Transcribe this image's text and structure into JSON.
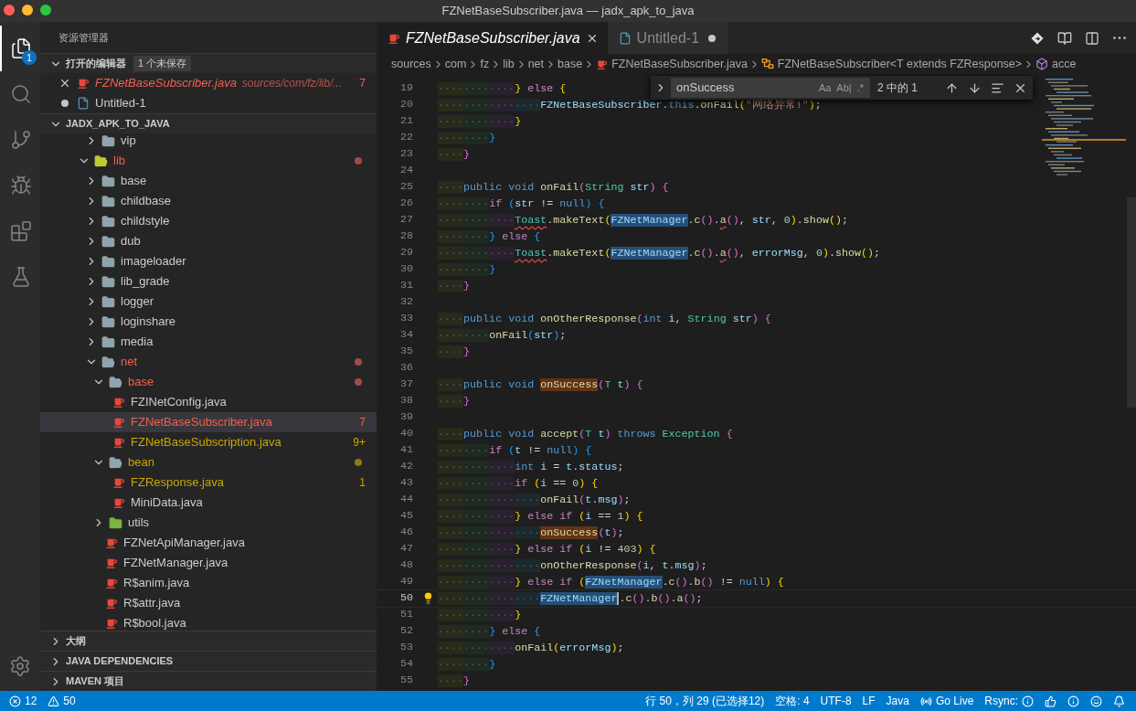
{
  "window": {
    "title": "FZNetBaseSubscriber.java — jadx_apk_to_java"
  },
  "activity_bar": [
    {
      "kind": "explorer",
      "selected": true,
      "badge": "1"
    },
    {
      "kind": "search",
      "selected": false
    },
    {
      "kind": "source-control",
      "selected": false
    },
    {
      "kind": "debug",
      "selected": false
    },
    {
      "kind": "extensions",
      "selected": false
    },
    {
      "kind": "testing",
      "selected": false
    }
  ],
  "sidebar": {
    "title": "资源管理器",
    "open_editors": {
      "label": "打开的编辑器",
      "expanded": true,
      "badge": "1 个未保存",
      "items": [
        {
          "name": "FZNetBaseSubscriber.java",
          "path": "sources/com/fz/lib/...",
          "badge": "7",
          "kind": "java-file",
          "has_errors": true,
          "preview": true,
          "dirty": false
        },
        {
          "name": "Untitled-1",
          "kind": "text-file",
          "dirty": true,
          "preview": false
        }
      ]
    },
    "project": {
      "label": "JADX_APK_TO_JAVA",
      "expanded": true,
      "tree": [
        {
          "children": [
            {
              "name": "vip",
              "kind": "folder",
              "expanded": false
            }
          ]
        },
        {
          "name": "lib",
          "kind": "lib-folder",
          "expanded": true,
          "has_errors": true,
          "children": [
            {
              "name": "base",
              "kind": "folder",
              "expanded": false
            },
            {
              "name": "childbase",
              "kind": "folder",
              "expanded": false
            },
            {
              "name": "childstyle",
              "kind": "folder",
              "expanded": false
            },
            {
              "name": "dub",
              "kind": "folder",
              "expanded": false
            },
            {
              "name": "imageloader",
              "kind": "folder",
              "expanded": false
            },
            {
              "name": "lib_grade",
              "kind": "folder",
              "expanded": false
            },
            {
              "name": "logger",
              "kind": "folder",
              "expanded": false
            },
            {
              "name": "loginshare",
              "kind": "folder",
              "expanded": false
            },
            {
              "name": "media",
              "kind": "folder",
              "expanded": false
            },
            {
              "name": "net",
              "kind": "folder",
              "expanded": true,
              "has_errors": true,
              "children": [
                {
                  "name": "base",
                  "kind": "folder",
                  "expanded": true,
                  "has_errors": true,
                  "children": [
                    {
                      "name": "FZINetConfig.java",
                      "kind": "java-file",
                      "selected": false
                    },
                    {
                      "name": "FZNetBaseSubscriber.java",
                      "kind": "java-file",
                      "has_errors": true,
                      "badge": "7",
                      "selected": true
                    },
                    {
                      "name": "FZNetBaseSubscription.java",
                      "kind": "java-file",
                      "has_warnings": true,
                      "badge": "9+",
                      "selected": false
                    }
                  ]
                },
                {
                  "name": "bean",
                  "kind": "folder",
                  "expanded": true,
                  "has_warnings": true,
                  "children": [
                    {
                      "name": "FZResponse.java",
                      "kind": "java-file",
                      "has_warnings": true,
                      "badge": "1",
                      "selected": false
                    },
                    {
                      "name": "MiniData.java",
                      "kind": "java-file",
                      "selected": false
                    }
                  ]
                },
                {
                  "name": "utils",
                  "kind": "utils-folder",
                  "expanded": false
                },
                {
                  "name": "FZNetApiManager.java",
                  "kind": "java-file",
                  "selected": false
                },
                {
                  "name": "FZNetManager.java",
                  "kind": "java-file",
                  "selected": false
                },
                {
                  "name": "R$anim.java",
                  "kind": "java-file",
                  "selected": false
                },
                {
                  "name": "R$attr.java",
                  "kind": "java-file",
                  "selected": false
                },
                {
                  "name": "R$bool.java",
                  "kind": "java-file",
                  "selected": false
                }
              ]
            }
          ]
        }
      ]
    },
    "sections": [
      {
        "label": "大纲",
        "expanded": false
      },
      {
        "label": "JAVA DEPENDENCIES",
        "expanded": false
      },
      {
        "label": "MAVEN 项目",
        "expanded": false
      }
    ]
  },
  "tabs": [
    {
      "label": "FZNetBaseSubscriber.java",
      "kind": "java-file",
      "selected": true,
      "preview": true,
      "dirty": false
    },
    {
      "label": "Untitled-1",
      "kind": "text-file",
      "selected": false,
      "preview": false,
      "dirty": true
    }
  ],
  "editor_actions": [
    {
      "kind": "open-changes"
    },
    {
      "kind": "preview"
    },
    {
      "kind": "split"
    },
    {
      "kind": "more"
    }
  ],
  "breadcrumbs": [
    {
      "label": "sources"
    },
    {
      "label": "com"
    },
    {
      "label": "fz"
    },
    {
      "label": "lib"
    },
    {
      "label": "net"
    },
    {
      "label": "base"
    },
    {
      "label": "FZNetBaseSubscriber.java",
      "kind": "java-file"
    },
    {
      "label": "FZNetBaseSubscriber<T extends FZResponse>",
      "kind": "class"
    },
    {
      "label": "acce",
      "kind": "method"
    }
  ],
  "find_widget": {
    "value": "onSuccess",
    "options": [
      "Aa",
      "Ab|",
      ".*"
    ],
    "count": "2 中的 1"
  },
  "code_lines": [
    {
      "line_number": "19",
      "indent": "············",
      "tokens": [
        {
          "text": "}",
          "kind": "bracket-1"
        },
        {
          "text": " else ",
          "kind": "control"
        },
        {
          "text": "{",
          "kind": "bracket-1"
        }
      ]
    },
    {
      "line_number": "20",
      "indent": "················",
      "tokens": [
        {
          "text": "FZNetBaseSubscriber",
          "kind": "variable"
        },
        {
          "text": ".",
          "kind": "plain"
        },
        {
          "text": "this",
          "kind": "keyword"
        },
        {
          "text": ".",
          "kind": "plain"
        },
        {
          "text": "onFail",
          "kind": "function"
        },
        {
          "text": "(",
          "kind": "bracket-1"
        },
        {
          "text": "\"网络异常!\"",
          "kind": "string"
        },
        {
          "text": ")",
          "kind": "bracket-1"
        },
        {
          "text": ";",
          "kind": "plain"
        }
      ]
    },
    {
      "line_number": "21",
      "indent": "············",
      "tokens": [
        {
          "text": "}",
          "kind": "bracket-1"
        }
      ]
    },
    {
      "line_number": "22",
      "indent": "········",
      "tokens": [
        {
          "text": "}",
          "kind": "bracket-3"
        }
      ]
    },
    {
      "line_number": "23",
      "indent": "····",
      "tokens": [
        {
          "text": "}",
          "kind": "bracket-2"
        }
      ]
    },
    {
      "line_number": "24"
    },
    {
      "line_number": "25",
      "indent": "····",
      "tokens": [
        {
          "text": "public void ",
          "kind": "keyword"
        },
        {
          "text": "onFail",
          "kind": "function"
        },
        {
          "text": "(",
          "kind": "bracket-2"
        },
        {
          "text": "String ",
          "kind": "type"
        },
        {
          "text": "str",
          "kind": "variable"
        },
        {
          "text": ")",
          "kind": "bracket-2"
        },
        {
          "text": " {",
          "kind": "bracket-2"
        }
      ]
    },
    {
      "line_number": "26",
      "indent": "········",
      "tokens": [
        {
          "text": "if ",
          "kind": "control"
        },
        {
          "text": "(",
          "kind": "bracket-3"
        },
        {
          "text": "str",
          "kind": "variable"
        },
        {
          "text": " != ",
          "kind": "plain"
        },
        {
          "text": "null",
          "kind": "keyword"
        },
        {
          "text": ")",
          "kind": "bracket-3"
        },
        {
          "text": " {",
          "kind": "bracket-3"
        }
      ]
    },
    {
      "line_number": "27",
      "indent": "············",
      "tokens": [
        {
          "text": "Toast",
          "kind": "type",
          "squiggle": true
        },
        {
          "text": ".",
          "kind": "plain"
        },
        {
          "text": "makeText",
          "kind": "function"
        },
        {
          "text": "(",
          "kind": "bracket-1"
        },
        {
          "text": "FZNetManager",
          "kind": "variable",
          "highlighted": true
        },
        {
          "text": ".",
          "kind": "plain"
        },
        {
          "text": "c",
          "kind": "function"
        },
        {
          "text": "()",
          "kind": "bracket-2"
        },
        {
          "text": ".",
          "kind": "plain"
        },
        {
          "text": "a",
          "kind": "function",
          "squiggle": true
        },
        {
          "text": "()",
          "kind": "bracket-2"
        },
        {
          "text": ", ",
          "kind": "plain"
        },
        {
          "text": "str",
          "kind": "variable"
        },
        {
          "text": ", ",
          "kind": "plain"
        },
        {
          "text": "0",
          "kind": "number"
        },
        {
          "text": ")",
          "kind": "bracket-1"
        },
        {
          "text": ".",
          "kind": "plain"
        },
        {
          "text": "show",
          "kind": "function"
        },
        {
          "text": "()",
          "kind": "bracket-1"
        },
        {
          "text": ";",
          "kind": "plain"
        }
      ]
    },
    {
      "line_number": "28",
      "indent": "········",
      "tokens": [
        {
          "text": "}",
          "kind": "bracket-3"
        },
        {
          "text": " else ",
          "kind": "control"
        },
        {
          "text": "{",
          "kind": "bracket-3"
        }
      ]
    },
    {
      "line_number": "29",
      "indent": "············",
      "tokens": [
        {
          "text": "Toast",
          "kind": "type",
          "squiggle": true
        },
        {
          "text": ".",
          "kind": "plain"
        },
        {
          "text": "makeText",
          "kind": "function"
        },
        {
          "text": "(",
          "kind": "bracket-1"
        },
        {
          "text": "FZNetManager",
          "kind": "variable",
          "highlighted": true
        },
        {
          "text": ".",
          "kind": "plain"
        },
        {
          "text": "c",
          "kind": "function"
        },
        {
          "text": "()",
          "kind": "bracket-2"
        },
        {
          "text": ".",
          "kind": "plain"
        },
        {
          "text": "a",
          "kind": "function",
          "squiggle": true
        },
        {
          "text": "()",
          "kind": "bracket-2"
        },
        {
          "text": ", ",
          "kind": "plain"
        },
        {
          "text": "errorMsg",
          "kind": "variable"
        },
        {
          "text": ", ",
          "kind": "plain"
        },
        {
          "text": "0",
          "kind": "number"
        },
        {
          "text": ")",
          "kind": "bracket-1"
        },
        {
          "text": ".",
          "kind": "plain"
        },
        {
          "text": "show",
          "kind": "function"
        },
        {
          "text": "()",
          "kind": "bracket-1"
        },
        {
          "text": ";",
          "kind": "plain"
        }
      ]
    },
    {
      "line_number": "30",
      "indent": "········",
      "tokens": [
        {
          "text": "}",
          "kind": "bracket-3"
        }
      ]
    },
    {
      "line_number": "31",
      "indent": "····",
      "tokens": [
        {
          "text": "}",
          "kind": "bracket-2"
        }
      ]
    },
    {
      "line_number": "32"
    },
    {
      "line_number": "33",
      "indent": "····",
      "tokens": [
        {
          "text": "public void ",
          "kind": "keyword"
        },
        {
          "text": "onOtherResponse",
          "kind": "function"
        },
        {
          "text": "(",
          "kind": "bracket-2"
        },
        {
          "text": "int ",
          "kind": "keyword"
        },
        {
          "text": "i",
          "kind": "variable"
        },
        {
          "text": ", ",
          "kind": "plain"
        },
        {
          "text": "String ",
          "kind": "type"
        },
        {
          "text": "str",
          "kind": "variable"
        },
        {
          "text": ")",
          "kind": "bracket-2"
        },
        {
          "text": " {",
          "kind": "bracket-2"
        }
      ]
    },
    {
      "line_number": "34",
      "indent": "········",
      "tokens": [
        {
          "text": "onFail",
          "kind": "function"
        },
        {
          "text": "(",
          "kind": "bracket-3"
        },
        {
          "text": "str",
          "kind": "variable"
        },
        {
          "text": ")",
          "kind": "bracket-3"
        },
        {
          "text": ";",
          "kind": "plain"
        }
      ]
    },
    {
      "line_number": "35",
      "indent": "····",
      "tokens": [
        {
          "text": "}",
          "kind": "bracket-2"
        }
      ]
    },
    {
      "line_number": "36"
    },
    {
      "line_number": "37",
      "indent": "····",
      "tokens": [
        {
          "text": "public void ",
          "kind": "keyword"
        },
        {
          "text": "onSuccess",
          "kind": "function",
          "match": true
        },
        {
          "text": "(",
          "kind": "bracket-2"
        },
        {
          "text": "T ",
          "kind": "type"
        },
        {
          "text": "t",
          "kind": "variable"
        },
        {
          "text": ")",
          "kind": "bracket-2"
        },
        {
          "text": " {",
          "kind": "bracket-2"
        }
      ]
    },
    {
      "line_number": "38",
      "indent": "····",
      "tokens": [
        {
          "text": "}",
          "kind": "bracket-2"
        }
      ]
    },
    {
      "line_number": "39"
    },
    {
      "line_number": "40",
      "indent": "····",
      "tokens": [
        {
          "text": "public void ",
          "kind": "keyword"
        },
        {
          "text": "accept",
          "kind": "function"
        },
        {
          "text": "(",
          "kind": "bracket-2"
        },
        {
          "text": "T ",
          "kind": "type"
        },
        {
          "text": "t",
          "kind": "variable"
        },
        {
          "text": ")",
          "kind": "bracket-2"
        },
        {
          "text": " throws ",
          "kind": "keyword"
        },
        {
          "text": "Exception",
          "kind": "type"
        },
        {
          "text": " {",
          "kind": "bracket-2"
        }
      ]
    },
    {
      "line_number": "41",
      "indent": "········",
      "tokens": [
        {
          "text": "if ",
          "kind": "control"
        },
        {
          "text": "(",
          "kind": "bracket-3"
        },
        {
          "text": "t",
          "kind": "variable"
        },
        {
          "text": " != ",
          "kind": "plain"
        },
        {
          "text": "null",
          "kind": "keyword"
        },
        {
          "text": ")",
          "kind": "bracket-3"
        },
        {
          "text": " {",
          "kind": "bracket-3"
        }
      ]
    },
    {
      "line_number": "42",
      "indent": "············",
      "tokens": [
        {
          "text": "int ",
          "kind": "keyword"
        },
        {
          "text": "i",
          "kind": "variable"
        },
        {
          "text": " = ",
          "kind": "plain"
        },
        {
          "text": "t",
          "kind": "variable"
        },
        {
          "text": ".",
          "kind": "plain"
        },
        {
          "text": "status",
          "kind": "variable"
        },
        {
          "text": ";",
          "kind": "plain"
        }
      ]
    },
    {
      "line_number": "43",
      "indent": "············",
      "tokens": [
        {
          "text": "if ",
          "kind": "control"
        },
        {
          "text": "(",
          "kind": "bracket-1"
        },
        {
          "text": "i",
          "kind": "variable"
        },
        {
          "text": " == ",
          "kind": "plain"
        },
        {
          "text": "0",
          "kind": "number"
        },
        {
          "text": ")",
          "kind": "bracket-1"
        },
        {
          "text": " {",
          "kind": "bracket-1"
        }
      ]
    },
    {
      "line_number": "44",
      "indent": "················",
      "tokens": [
        {
          "text": "onFail",
          "kind": "function"
        },
        {
          "text": "(",
          "kind": "bracket-2"
        },
        {
          "text": "t",
          "kind": "variable"
        },
        {
          "text": ".",
          "kind": "plain"
        },
        {
          "text": "msg",
          "kind": "variable"
        },
        {
          "text": ")",
          "kind": "bracket-2"
        },
        {
          "text": ";",
          "kind": "plain"
        }
      ]
    },
    {
      "line_number": "45",
      "indent": "············",
      "tokens": [
        {
          "text": "}",
          "kind": "bracket-1"
        },
        {
          "text": " else if ",
          "kind": "control"
        },
        {
          "text": "(",
          "kind": "bracket-1"
        },
        {
          "text": "i",
          "kind": "variable"
        },
        {
          "text": " == ",
          "kind": "plain"
        },
        {
          "text": "1",
          "kind": "number"
        },
        {
          "text": ")",
          "kind": "bracket-1"
        },
        {
          "text": " {",
          "kind": "bracket-1"
        }
      ]
    },
    {
      "line_number": "46",
      "indent": "················",
      "tokens": [
        {
          "text": "onSuccess",
          "kind": "function",
          "match": true
        },
        {
          "text": "(",
          "kind": "bracket-2"
        },
        {
          "text": "t",
          "kind": "variable"
        },
        {
          "text": ")",
          "kind": "bracket-2"
        },
        {
          "text": ";",
          "kind": "plain"
        }
      ]
    },
    {
      "line_number": "47",
      "indent": "············",
      "tokens": [
        {
          "text": "}",
          "kind": "bracket-1"
        },
        {
          "text": " else if ",
          "kind": "control"
        },
        {
          "text": "(",
          "kind": "bracket-1"
        },
        {
          "text": "i",
          "kind": "variable"
        },
        {
          "text": " != ",
          "kind": "plain"
        },
        {
          "text": "403",
          "kind": "number"
        },
        {
          "text": ")",
          "kind": "bracket-1"
        },
        {
          "text": " {",
          "kind": "bracket-1"
        }
      ]
    },
    {
      "line_number": "48",
      "indent": "················",
      "tokens": [
        {
          "text": "onOtherResponse",
          "kind": "function"
        },
        {
          "text": "(",
          "kind": "bracket-2"
        },
        {
          "text": "i",
          "kind": "variable"
        },
        {
          "text": ", ",
          "kind": "plain"
        },
        {
          "text": "t",
          "kind": "variable"
        },
        {
          "text": ".",
          "kind": "plain"
        },
        {
          "text": "msg",
          "kind": "variable"
        },
        {
          "text": ")",
          "kind": "bracket-2"
        },
        {
          "text": ";",
          "kind": "plain"
        }
      ]
    },
    {
      "line_number": "49",
      "indent": "············",
      "tokens": [
        {
          "text": "}",
          "kind": "bracket-1"
        },
        {
          "text": " else if ",
          "kind": "control"
        },
        {
          "text": "(",
          "kind": "bracket-1"
        },
        {
          "text": "FZNetManager",
          "kind": "variable",
          "highlighted": true
        },
        {
          "text": ".",
          "kind": "plain"
        },
        {
          "text": "c",
          "kind": "function"
        },
        {
          "text": "()",
          "kind": "bracket-2"
        },
        {
          "text": ".",
          "kind": "plain"
        },
        {
          "text": "b",
          "kind": "function"
        },
        {
          "text": "()",
          "kind": "bracket-2"
        },
        {
          "text": " != ",
          "kind": "plain"
        },
        {
          "text": "null",
          "kind": "keyword"
        },
        {
          "text": ")",
          "kind": "bracket-1"
        },
        {
          "text": " {",
          "kind": "bracket-1"
        }
      ]
    },
    {
      "line_number": "50",
      "indent": "················",
      "current": true,
      "lightbulb": true,
      "tokens": [
        {
          "text": "FZNetManager",
          "kind": "variable",
          "highlighted": true,
          "cursor": true
        },
        {
          "text": ".",
          "kind": "plain"
        },
        {
          "text": "c",
          "kind": "function"
        },
        {
          "text": "()",
          "kind": "bracket-2"
        },
        {
          "text": ".",
          "kind": "plain"
        },
        {
          "text": "b",
          "kind": "function"
        },
        {
          "text": "()",
          "kind": "bracket-2"
        },
        {
          "text": ".",
          "kind": "plain"
        },
        {
          "text": "a",
          "kind": "function"
        },
        {
          "text": "()",
          "kind": "bracket-2"
        },
        {
          "text": ";",
          "kind": "plain"
        }
      ]
    },
    {
      "line_number": "51",
      "indent": "············",
      "tokens": [
        {
          "text": "}",
          "kind": "bracket-1"
        }
      ]
    },
    {
      "line_number": "52",
      "indent": "········",
      "tokens": [
        {
          "text": "}",
          "kind": "bracket-3"
        },
        {
          "text": " else ",
          "kind": "control"
        },
        {
          "text": "{",
          "kind": "bracket-3"
        }
      ]
    },
    {
      "line_number": "53",
      "indent": "············",
      "tokens": [
        {
          "text": "onFail",
          "kind": "function"
        },
        {
          "text": "(",
          "kind": "bracket-1"
        },
        {
          "text": "errorMsg",
          "kind": "variable"
        },
        {
          "text": ")",
          "kind": "bracket-1"
        },
        {
          "text": ";",
          "kind": "plain"
        }
      ]
    },
    {
      "line_number": "54",
      "indent": "········",
      "tokens": [
        {
          "text": "}",
          "kind": "bracket-3"
        }
      ]
    },
    {
      "line_number": "55",
      "indent": "····",
      "tokens": [
        {
          "text": "}",
          "kind": "bracket-2"
        }
      ]
    }
  ],
  "status_bar": {
    "left": [
      {
        "kind": "errors",
        "text": "12"
      },
      {
        "kind": "warnings",
        "text": "50"
      }
    ],
    "right": [
      {
        "kind": "text",
        "text": "行 50，列 29 (已选择12)"
      },
      {
        "kind": "text",
        "text": "空格: 4"
      },
      {
        "kind": "text",
        "text": "UTF-8"
      },
      {
        "kind": "text",
        "text": "LF"
      },
      {
        "kind": "text",
        "text": "Java"
      },
      {
        "kind": "live",
        "text": "Go Live"
      },
      {
        "kind": "rsync",
        "text": "Rsync:"
      },
      {
        "kind": "feedback"
      },
      {
        "kind": "info"
      },
      {
        "kind": "smiley"
      },
      {
        "kind": "notifications"
      }
    ]
  }
}
